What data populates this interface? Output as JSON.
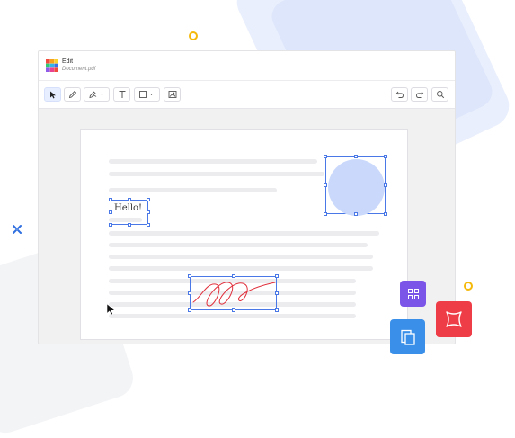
{
  "app": {
    "title": "Edit",
    "document_name": "Document.pdf"
  },
  "toolbar": {
    "tools_left": [
      "select-icon",
      "pencil-icon",
      "pen-icon",
      "text-icon",
      "shape-icon",
      "image-icon"
    ],
    "tools_right": [
      "undo-icon",
      "redo-icon",
      "search-icon"
    ]
  },
  "document": {
    "hello_text": "Hello!"
  },
  "colors": {
    "accent": "#4a78e6",
    "selection": "#4a78e6",
    "circle_fill": "#cad9fb",
    "signature": "#e0303c",
    "card_purple": "#7b55e8",
    "card_blue": "#3a8fe8",
    "card_red": "#ef3d47"
  }
}
